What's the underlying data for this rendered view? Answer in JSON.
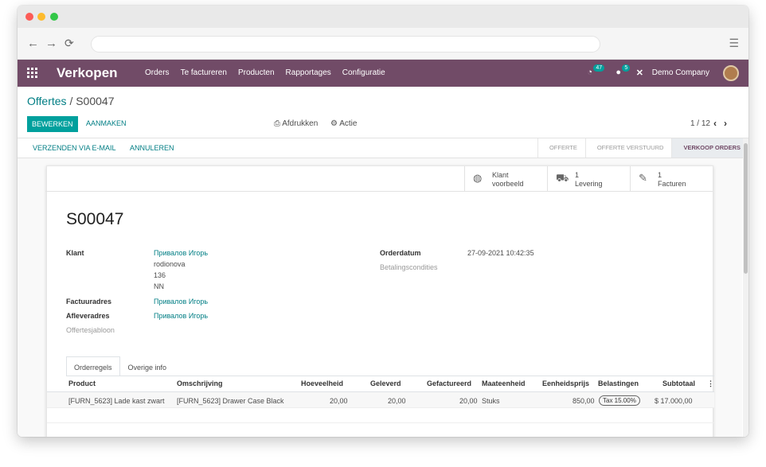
{
  "nav": {
    "brand": "Verkopen",
    "menu": [
      "Orders",
      "Te factureren",
      "Producten",
      "Rapportages",
      "Configuratie"
    ],
    "activity_count": "47",
    "message_count": "5",
    "company": "Demo Company"
  },
  "breadcrumb": {
    "parent": "Offertes",
    "separator": "/",
    "current": "S00047"
  },
  "controls": {
    "edit": "BEWERKEN",
    "create": "AANMAKEN",
    "print": "Afdrukken",
    "action": "Actie",
    "pager": "1 / 12"
  },
  "status": {
    "actions": [
      "VERZENDEN VIA E-MAIL",
      "ANNULEREN"
    ],
    "stages": [
      "OFFERTE",
      "OFFERTE VERSTUURD",
      "VERKOOP ORDERS"
    ]
  },
  "smart": {
    "customer_line1": "Klant",
    "customer_line2": "voorbeeld",
    "delivery_count": "1",
    "delivery_label": "Levering",
    "invoice_count": "1",
    "invoice_label": "Facturen"
  },
  "order": {
    "name": "S00047",
    "customer_label": "Klant",
    "customer": "Привалов Игорь",
    "addr1": "rodionova",
    "addr2": "136",
    "addr3": "NN",
    "invoice_addr_label": "Factuuradres",
    "invoice_addr": "Привалов Игорь",
    "delivery_addr_label": "Afleveradres",
    "delivery_addr": "Привалов Игорь",
    "template_label": "Offertesjabloon",
    "date_label": "Orderdatum",
    "date": "27-09-2021 10:42:35",
    "terms_label": "Betalingscondities"
  },
  "tabs": [
    "Orderregels",
    "Overige info"
  ],
  "lines": {
    "headers": [
      "Product",
      "Omschrijving",
      "Hoeveelheid",
      "Geleverd",
      "Gefactureerd",
      "Maateenheid",
      "Eenheidsprijs",
      "Belastingen",
      "Subtotaal"
    ],
    "rows": [
      {
        "product": "[FURN_5623] Lade kast zwart",
        "description": "[FURN_5623] Drawer Case Black",
        "qty": "20,00",
        "delivered": "20,00",
        "invoiced": "20,00",
        "uom": "Stuks",
        "price": "850,00",
        "tax": "Tax 15.00%",
        "subtotal": "$ 17.000,00"
      }
    ]
  }
}
